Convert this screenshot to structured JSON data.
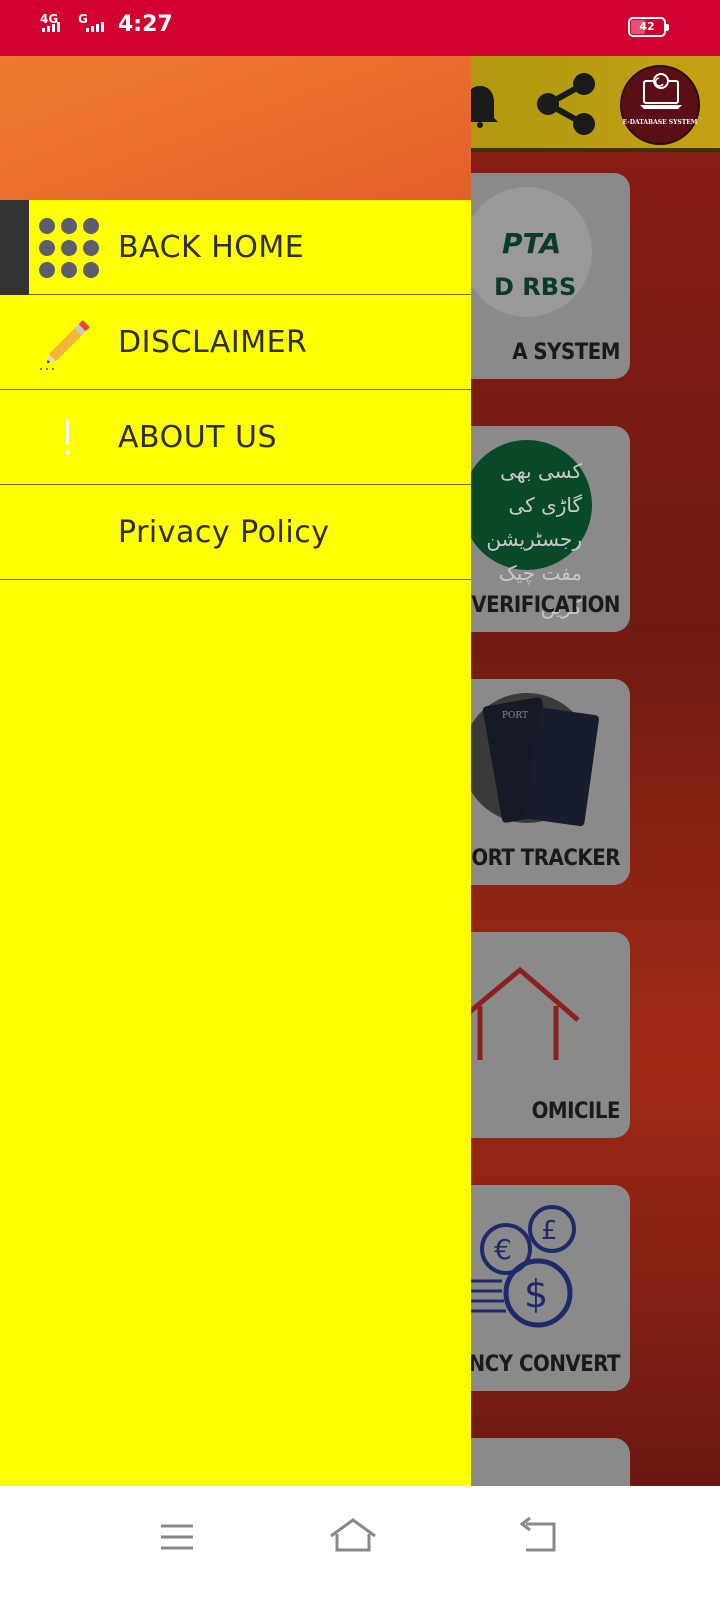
{
  "status_bar": {
    "network_1": "4G",
    "network_2": "G",
    "time": "4:27",
    "battery": "42"
  },
  "background_app": {
    "cards": [
      {
        "label": "A SYSTEM",
        "logo_text_1": "PTA",
        "logo_text_2": "D RBS"
      },
      {
        "label": "E VERIFICATION",
        "logo_text": "کسی بھی گاڑی کی رجسٹریشن مفت چیک کریں"
      },
      {
        "label": "ORT TRACKER",
        "logo_text": "PORT"
      },
      {
        "label": "OMICILE"
      },
      {
        "label": "NCY CONVERT"
      }
    ],
    "logo_text": "E-DATABASE SYSTEM"
  },
  "drawer": {
    "items": [
      {
        "label": "BACK HOME",
        "icon": "grid-dots-icon",
        "active": true
      },
      {
        "label": "DISCLAIMER",
        "icon": "pencil-icon",
        "active": false
      },
      {
        "label": "ABOUT US",
        "icon": "alert-icon",
        "active": false
      },
      {
        "label": "Privacy Policy",
        "icon": "",
        "active": false
      }
    ]
  },
  "navbar": {
    "buttons": [
      "menu-icon",
      "home-icon",
      "back-icon"
    ]
  },
  "colors": {
    "status_bar": "#d10030",
    "drawer_bg": "#ffff00",
    "drawer_header": "#e8682c",
    "active_marker": "#333333"
  }
}
